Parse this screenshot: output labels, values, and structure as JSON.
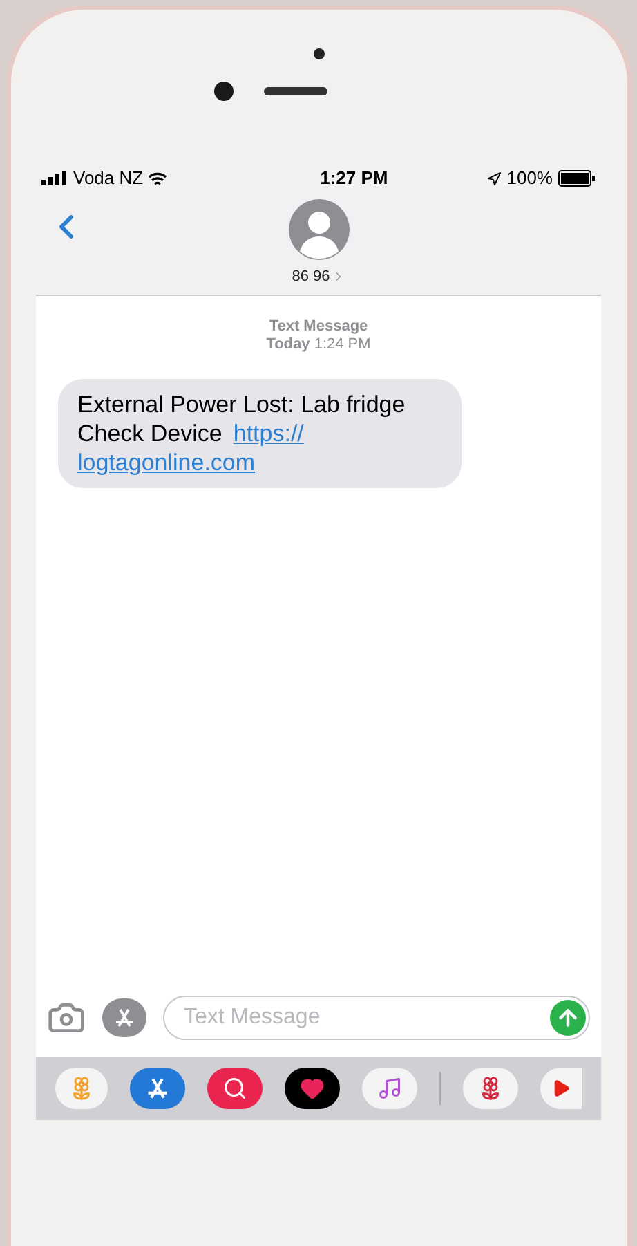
{
  "status_bar": {
    "carrier": "Voda NZ",
    "time": "1:27 PM",
    "battery": "100%"
  },
  "header": {
    "contact": "86 96"
  },
  "conversation": {
    "service": "Text Message",
    "timestamp": "**Today** 1:24 PM"
  },
  "messages": [
    {
      "text_lines": [
        "External Power Lost: Lab fridge",
        "Check Device"
      ],
      "link_lines": [
        "https://",
        "logtagonline.com"
      ]
    }
  ],
  "compose": {
    "placeholder": "Text Message"
  }
}
